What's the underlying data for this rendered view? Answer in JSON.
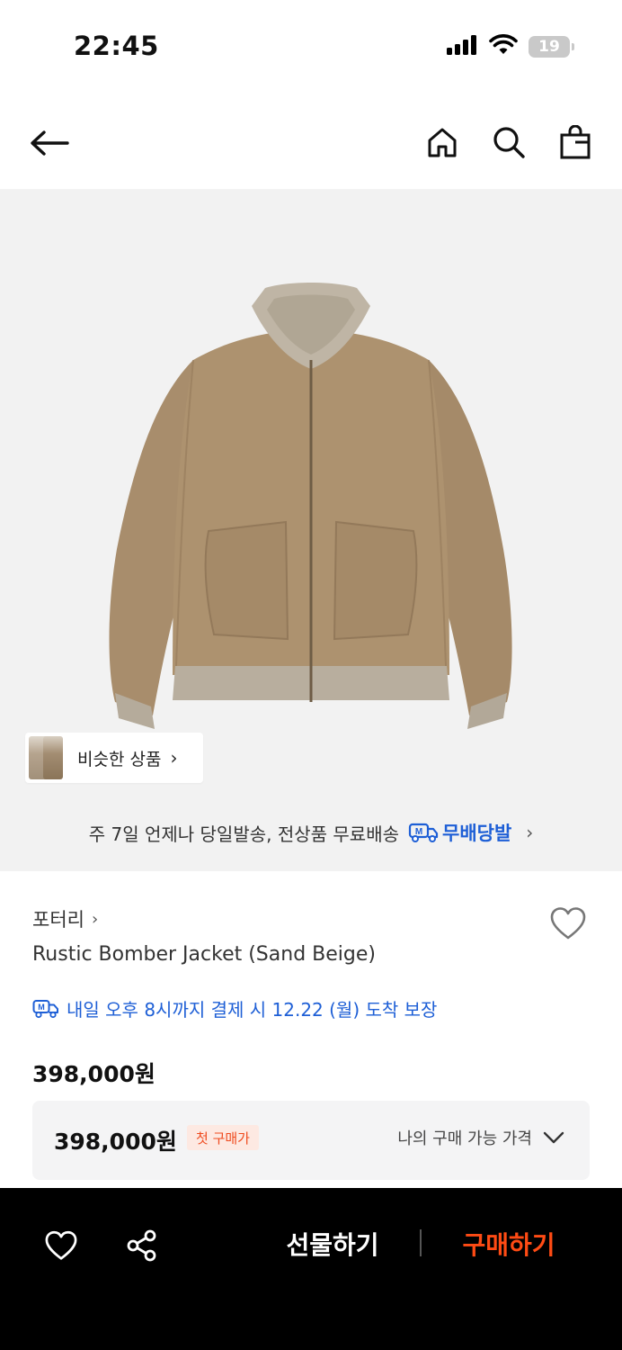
{
  "status_bar": {
    "time": "22:45",
    "battery": "19"
  },
  "nav": {
    "back_icon": "arrow-left-icon",
    "home_icon": "home-icon",
    "search_icon": "search-icon",
    "bag_icon": "shopping-bag-icon"
  },
  "hero": {
    "similar_label": "비슷한 상품",
    "shipping_text": "주 7일 언제나 당일발송, 전상품 무료배송",
    "mubaedang_label": "무배당발"
  },
  "product": {
    "brand": "포터리",
    "name": "Rustic Bomber Jacket (Sand Beige)",
    "delivery_guarantee": "내일 오후 8시까지 결제 시 12.22 (월) 도착 보장",
    "price": "398,000원",
    "box_price": "398,000원",
    "first_purchase_badge": "첫 구매가",
    "my_price_label": "나의 구매 가능 가격"
  },
  "bottom_bar": {
    "gift_label": "선물하기",
    "buy_label": "구매하기"
  },
  "colors": {
    "accent_blue": "#1e5fd6",
    "buy_orange": "#ff4b14",
    "badge_red": "#ef4b1f",
    "jacket_tan": "#a38866"
  }
}
